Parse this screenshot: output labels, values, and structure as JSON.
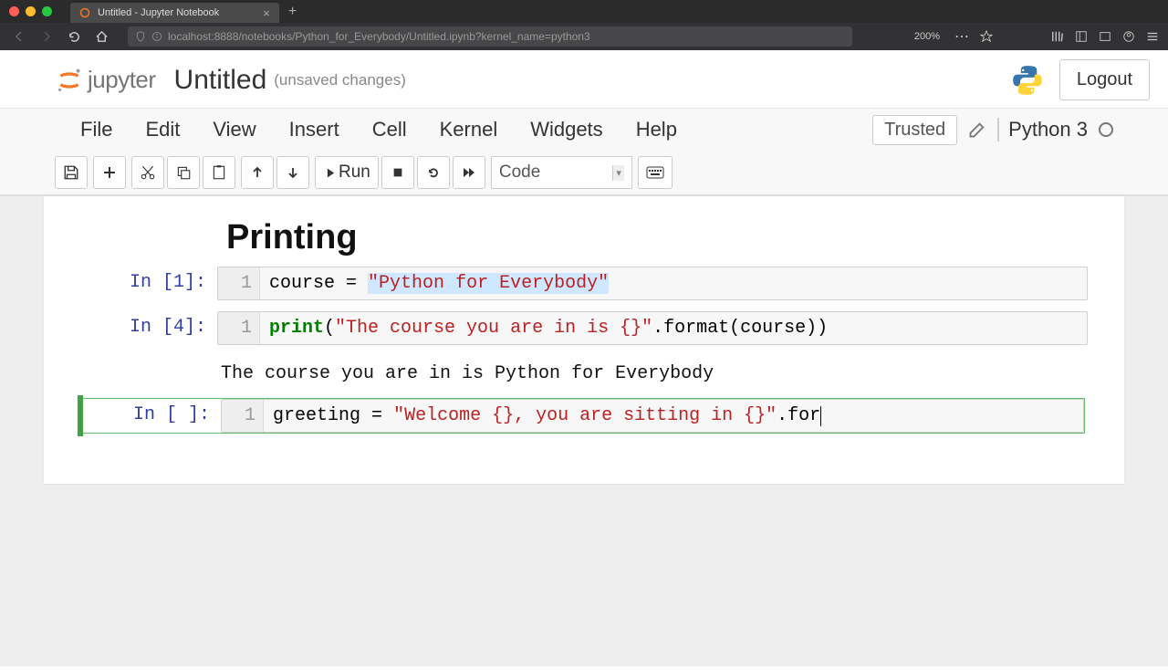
{
  "browser": {
    "tab_title": "Untitled - Jupyter Notebook",
    "url": "localhost:8888/notebooks/Python_for_Everybody/Untitled.ipynb?kernel_name=python3",
    "zoom": "200%"
  },
  "header": {
    "logo_text": "jupyter",
    "title": "Untitled",
    "unsaved": "(unsaved changes)",
    "logout": "Logout"
  },
  "menubar": {
    "items": [
      "File",
      "Edit",
      "View",
      "Insert",
      "Cell",
      "Kernel",
      "Widgets",
      "Help"
    ],
    "trusted": "Trusted",
    "kernel": "Python 3"
  },
  "toolbar": {
    "run": "Run",
    "celltype": "Code"
  },
  "notebook": {
    "heading": "Printing",
    "cells": [
      {
        "prompt": "In [1]:",
        "lineno": "1",
        "tokens": [
          {
            "t": "course ",
            "c": ""
          },
          {
            "t": "=",
            "c": ""
          },
          {
            "t": " ",
            "c": ""
          },
          {
            "t": "\"Python for Everybody\"",
            "c": "selstr"
          }
        ]
      },
      {
        "prompt": "In [4]:",
        "lineno": "1",
        "tokens": [
          {
            "t": "print",
            "c": "kw"
          },
          {
            "t": "(",
            "c": ""
          },
          {
            "t": "\"The course you are in is {}\"",
            "c": "str"
          },
          {
            "t": ".",
            "c": ""
          },
          {
            "t": "format",
            "c": ""
          },
          {
            "t": "(",
            "c": ""
          },
          {
            "t": "course",
            "c": ""
          },
          {
            "t": ")",
            "c": ""
          },
          {
            "t": ")",
            "c": ""
          }
        ],
        "output": "The course you are in is Python for Everybody"
      },
      {
        "prompt": "In [ ]:",
        "lineno": "1",
        "active": true,
        "tokens": [
          {
            "t": "greeting ",
            "c": ""
          },
          {
            "t": "=",
            "c": ""
          },
          {
            "t": " ",
            "c": ""
          },
          {
            "t": "\"Welcome {}, you are sitting in {}\"",
            "c": "str"
          },
          {
            "t": ".",
            "c": ""
          },
          {
            "t": "for",
            "c": ""
          }
        ]
      }
    ]
  }
}
